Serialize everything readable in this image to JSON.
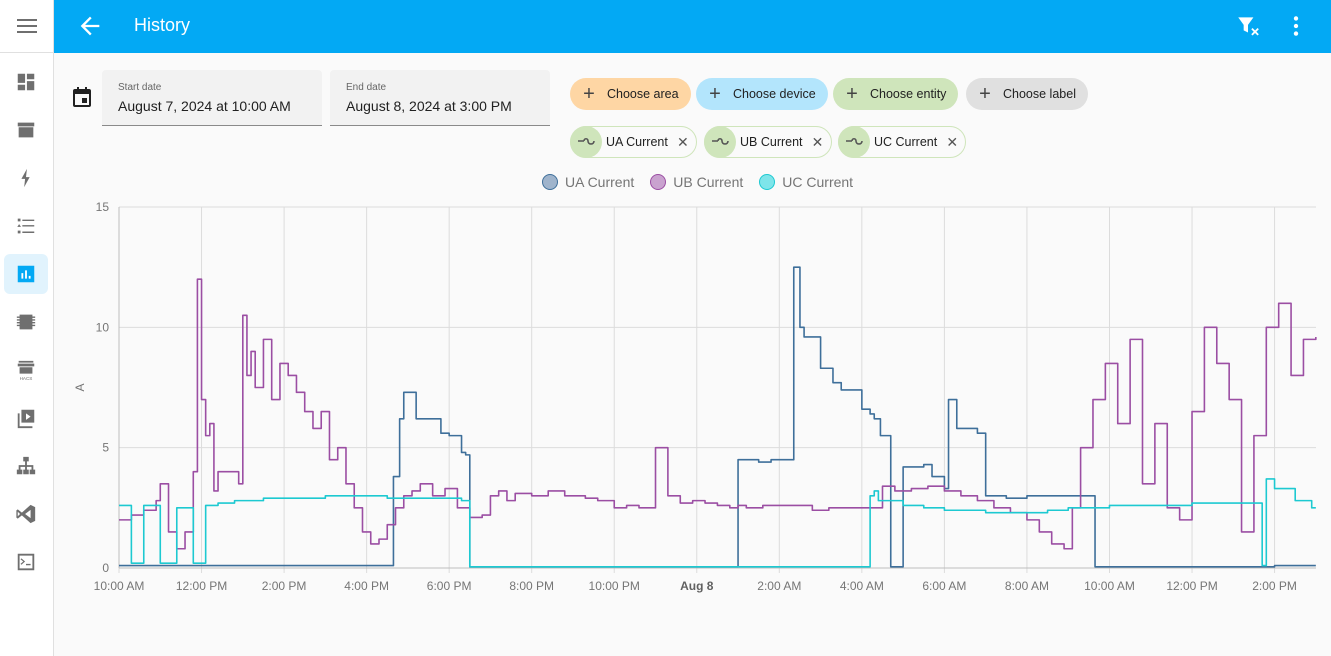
{
  "sidebar": {
    "items": [
      {
        "name": "overview",
        "icon": "dashboard-icon"
      },
      {
        "name": "map",
        "icon": "archive-box-icon"
      },
      {
        "name": "energy",
        "icon": "lightning-icon"
      },
      {
        "name": "logbook",
        "icon": "list-icon"
      },
      {
        "name": "history",
        "icon": "chart-bar-icon",
        "active": true
      },
      {
        "name": "developer",
        "icon": "chip-icon"
      },
      {
        "name": "hacs",
        "icon": "store-icon",
        "label": "HACS"
      },
      {
        "name": "media",
        "icon": "play-box-icon"
      },
      {
        "name": "network",
        "icon": "sitemap-icon"
      },
      {
        "name": "vscode",
        "icon": "vscode-icon"
      },
      {
        "name": "terminal",
        "icon": "terminal-icon"
      }
    ]
  },
  "header": {
    "title": "History",
    "accent": "#03a9f4"
  },
  "dates": {
    "start_label": "Start date",
    "start_value": "August 7, 2024 at 10:00 AM",
    "end_label": "End date",
    "end_value": "August 8, 2024 at 3:00 PM"
  },
  "pickers": [
    {
      "label": "Choose area",
      "color": "#fed6a4"
    },
    {
      "label": "Choose device",
      "color": "#b3e5fc"
    },
    {
      "label": "Choose entity",
      "color": "#cfe5bb"
    },
    {
      "label": "Choose label",
      "color": "#e0e0e0"
    }
  ],
  "selected_entities": [
    {
      "label": "UA Current"
    },
    {
      "label": "UB Current"
    },
    {
      "label": "UC Current"
    }
  ],
  "chart_data": {
    "type": "line",
    "title": "",
    "xlabel": "",
    "ylabel": "A",
    "ylim": [
      0,
      15
    ],
    "yticks": [
      "0",
      "5",
      "10",
      "15"
    ],
    "xlim_hours": [
      0,
      29
    ],
    "xticks": [
      {
        "h": 0,
        "label": "10:00 AM"
      },
      {
        "h": 2,
        "label": "12:00 PM"
      },
      {
        "h": 4,
        "label": "2:00 PM"
      },
      {
        "h": 6,
        "label": "4:00 PM"
      },
      {
        "h": 8,
        "label": "6:00 PM"
      },
      {
        "h": 10,
        "label": "8:00 PM"
      },
      {
        "h": 12,
        "label": "10:00 PM"
      },
      {
        "h": 14,
        "label": "Aug 8",
        "bold": true
      },
      {
        "h": 16,
        "label": "2:00 AM"
      },
      {
        "h": 18,
        "label": "4:00 AM"
      },
      {
        "h": 20,
        "label": "6:00 AM"
      },
      {
        "h": 22,
        "label": "8:00 AM"
      },
      {
        "h": 24,
        "label": "10:00 AM"
      },
      {
        "h": 26,
        "label": "12:00 PM"
      },
      {
        "h": 28,
        "label": "2:00 PM"
      }
    ],
    "grid": true,
    "legend_position": "top-center",
    "series": [
      {
        "name": "UA Current",
        "color": "#3e6f9a",
        "fill": "#9fb4cc",
        "x": [
          0,
          2,
          2.8,
          3.6,
          4.5,
          6,
          6.6,
          6.65,
          6.8,
          6.9,
          7.2,
          7.8,
          8.0,
          8.3,
          8.4,
          8.5,
          9,
          10,
          12,
          14,
          14.9,
          15,
          15.2,
          15.5,
          15.8,
          16.3,
          16.35,
          16.5,
          16.6,
          17,
          17.3,
          17.5,
          18,
          18.2,
          18.3,
          18.45,
          18.7,
          19,
          19.5,
          19.7,
          20,
          20.1,
          20.3,
          20.8,
          21,
          21.5,
          22,
          23,
          23.6,
          23.65,
          24,
          26,
          28,
          29
        ],
        "y": [
          0.1,
          0.1,
          0.1,
          0.1,
          0.1,
          0.1,
          0.1,
          3.8,
          6.2,
          7.3,
          6.2,
          5.6,
          5.5,
          4.8,
          4.7,
          0.05,
          0.05,
          0.05,
          0.05,
          0.05,
          0.05,
          4.5,
          4.5,
          4.4,
          4.5,
          4.5,
          12.5,
          10.0,
          9.6,
          8.3,
          7.7,
          7.4,
          6.6,
          6.4,
          6.2,
          5.5,
          0.05,
          4.2,
          4.3,
          3.8,
          3.3,
          7.0,
          5.8,
          5.6,
          3.0,
          2.9,
          3.0,
          3.0,
          3.0,
          0.05,
          0.05,
          0.05,
          0.1,
          0.1
        ]
      },
      {
        "name": "UB Current",
        "color": "#9b4ea3",
        "fill": "#c9a2cf",
        "x": [
          0,
          0.3,
          0.6,
          0.9,
          1.0,
          1.2,
          1.4,
          1.6,
          1.8,
          1.9,
          2.0,
          2.1,
          2.2,
          2.3,
          2.4,
          2.9,
          3.0,
          3.1,
          3.2,
          3.3,
          3.5,
          3.7,
          3.9,
          4.1,
          4.3,
          4.5,
          4.7,
          4.9,
          5.1,
          5.3,
          5.5,
          5.7,
          5.9,
          6.1,
          6.3,
          6.5,
          6.7,
          6.9,
          7.1,
          7.3,
          7.6,
          7.9,
          8.2,
          8.5,
          8.8,
          9,
          9.2,
          9.4,
          9.6,
          10,
          10.4,
          10.8,
          11,
          11.3,
          11.6,
          12,
          12.3,
          12.6,
          13,
          13.3,
          13.6,
          13.9,
          14.2,
          14.5,
          14.8,
          15.0,
          15.2,
          15.6,
          16,
          16.4,
          16.8,
          17.2,
          17.5,
          17.8,
          18.2,
          18.5,
          18.8,
          19.2,
          19.6,
          20,
          20.4,
          20.8,
          21.2,
          21.6,
          22,
          22.3,
          22.6,
          22.9,
          23.1,
          23.3,
          23.6,
          23.9,
          24.2,
          24.5,
          24.8,
          25.1,
          25.4,
          25.7,
          26,
          26.3,
          26.6,
          26.9,
          27.2,
          27.5,
          27.8,
          28.1,
          28.4,
          28.7,
          29
        ],
        "y": [
          2.0,
          2.2,
          2.4,
          2.8,
          3.5,
          1.5,
          0.8,
          1.5,
          4.0,
          12.0,
          7.0,
          5.5,
          6.0,
          3.2,
          4.0,
          3.5,
          10.5,
          8.0,
          9.0,
          7.5,
          9.5,
          7.0,
          8.5,
          8.0,
          7.3,
          6.5,
          5.8,
          6.5,
          4.5,
          5.0,
          3.5,
          2.5,
          1.5,
          1.0,
          1.2,
          1.8,
          2.5,
          3.0,
          3.2,
          3.5,
          3.0,
          3.3,
          2.5,
          2.1,
          2.2,
          3.0,
          3.2,
          2.8,
          3.1,
          3.0,
          3.2,
          3.0,
          3.0,
          2.9,
          2.8,
          2.5,
          2.6,
          2.5,
          5.0,
          3.0,
          2.7,
          2.8,
          2.7,
          2.6,
          2.5,
          2.6,
          2.5,
          2.6,
          2.6,
          2.6,
          2.4,
          2.5,
          2.5,
          2.5,
          2.5,
          3.4,
          3.2,
          3.3,
          3.4,
          3.2,
          3.0,
          2.8,
          2.5,
          2.3,
          2.0,
          1.5,
          1.0,
          0.8,
          2.5,
          5.0,
          7.0,
          8.5,
          6.0,
          9.5,
          3.5,
          6.0,
          2.5,
          2.0,
          6.5,
          10.0,
          8.5,
          7.0,
          1.5,
          5.5,
          10.0,
          11.0,
          8.0,
          9.5,
          9.6
        ]
      },
      {
        "name": "UC Current",
        "color": "#1dc9d1",
        "fill": "#7ee5ea",
        "x": [
          0,
          0.2,
          0.3,
          0.5,
          0.6,
          0.9,
          1.0,
          1.3,
          1.4,
          1.5,
          1.8,
          1.9,
          2.1,
          2.2,
          2.4,
          2.8,
          3.0,
          3.5,
          4,
          5,
          6,
          6.5,
          7,
          7.5,
          8,
          8.3,
          8.5,
          9,
          10,
          12,
          14,
          16,
          18,
          18.2,
          18.3,
          18.4,
          19,
          19.5,
          20,
          20.5,
          21,
          21.5,
          22,
          22.5,
          23,
          23.5,
          24,
          25,
          26,
          27,
          27.7,
          27.8,
          28.0,
          28.5,
          28.9,
          29
        ],
        "y": [
          2.6,
          2.6,
          0.2,
          0.2,
          2.6,
          2.6,
          0.2,
          0.2,
          2.5,
          2.5,
          0.2,
          0.2,
          2.6,
          2.6,
          2.7,
          2.8,
          2.8,
          2.9,
          2.9,
          3.0,
          3.0,
          2.9,
          2.9,
          2.9,
          2.9,
          2.8,
          0.05,
          0.05,
          0.05,
          0.05,
          0.05,
          0.05,
          0.05,
          3.0,
          3.2,
          2.8,
          2.6,
          2.5,
          2.4,
          2.4,
          2.3,
          2.3,
          2.3,
          2.4,
          2.5,
          2.5,
          2.6,
          2.6,
          2.7,
          2.7,
          0.1,
          3.7,
          3.3,
          2.8,
          2.5,
          2.5
        ]
      }
    ]
  }
}
